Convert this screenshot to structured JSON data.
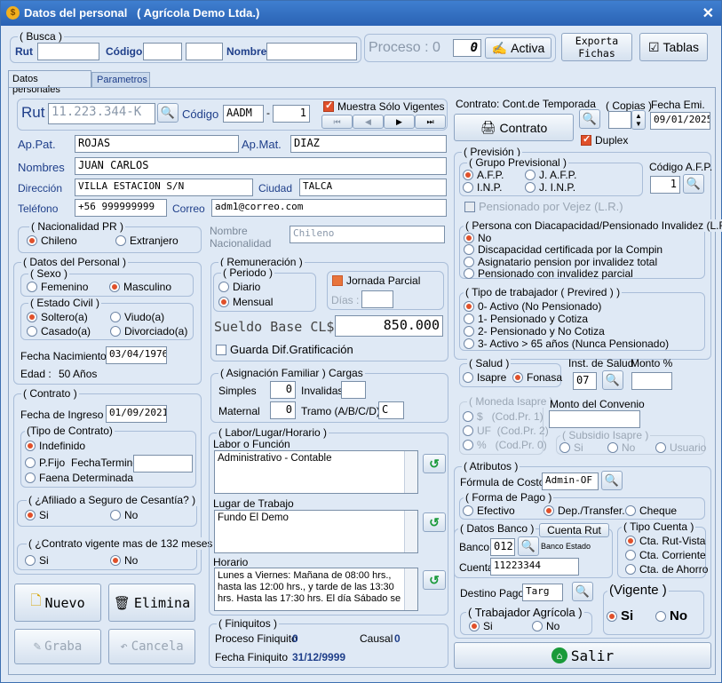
{
  "title": "Datos del personal   ( Agrícola Demo Ltda.)",
  "busca": {
    "group": "( Busca )",
    "rut": "Rut",
    "codigo": "Código",
    "nombre": "Nombre"
  },
  "proceso": {
    "label": "Proceso : 0",
    "value": "0",
    "activa": "Activa",
    "exporta": "Exporta\nFichas",
    "tablas": "Tablas"
  },
  "tabs": [
    "Datos personales",
    "Parametros"
  ],
  "persona": {
    "rut_label": "Rut",
    "rut": "11.223.344-K",
    "codigo_label": "Código",
    "codigo": "AADM",
    "codigo_num": "1",
    "muestra": "Muestra Sólo Vigentes",
    "appat_label": "Ap.Pat.",
    "appat": "ROJAS",
    "apmat_label": "Ap.Mat.",
    "apmat": "DIAZ",
    "nombres_label": "Nombres",
    "nombres": "JUAN CARLOS",
    "direccion_label": "Dirección",
    "direccion": "VILLA ESTACION S/N",
    "ciudad_label": "Ciudad",
    "ciudad": "TALCA",
    "telefono_label": "Teléfono",
    "telefono": "+56 999999999",
    "correo_label": "Correo",
    "correo": "adm1@correo.com",
    "nacionalidad_pr": "( Nacionalidad PR )",
    "chileno": "Chileno",
    "extranjero": "Extranjero",
    "nombre_nac_label1": "Nombre",
    "nombre_nac_label2": "Nacionalidad",
    "nombre_nac": "Chileno"
  },
  "datos_personal": {
    "group": "( Datos del Personal )",
    "sexo": "( Sexo )",
    "femenino": "Femenino",
    "masculino": "Masculino",
    "estado_civil": "( Estado Civil )",
    "soltero": "Soltero(a)",
    "viudo": "Viudo(a)",
    "casado": "Casado(a)",
    "divorciado": "Divorciado(a)",
    "fnac_label": "Fecha Nacimiento",
    "fnac": "03/04/1976",
    "edad_label": "Edad :",
    "edad": "50 Años"
  },
  "contrato": {
    "group": "( Contrato )",
    "fingreso_label": "Fecha de Ingreso",
    "fingreso": "01/09/2021",
    "tipo": "(Tipo de Contrato)",
    "indefinido": "Indefinido",
    "pfijo": "P.Fijo",
    "ftermino": "FechaTermino",
    "faena": "Faena Determinada",
    "afiliado": "( ¿Afiliado a Seguro de Cesantía? )",
    "si": "Si",
    "no": "No",
    "vigente132": "( ¿Contrato vigente mas de 132 meses ? )"
  },
  "buttons": {
    "nuevo": "Nuevo",
    "elimina": "Elimina",
    "graba": "Graba",
    "cancela": "Cancela",
    "salir": "Salir"
  },
  "remuneracion": {
    "group": "( Remuneración )",
    "periodo": "( Periodo )",
    "diario": "Diario",
    "mensual": "Mensual",
    "jornada": "Jornada Parcial",
    "dias": "Días :",
    "sueldo_label": "Sueldo Base CL$",
    "sueldo": "850.000",
    "guarda": "Guarda Dif.Gratificación"
  },
  "asignacion": {
    "group": "( Asignación Familiar ) Cargas",
    "simples": "Simples",
    "simples_v": "0",
    "invalidas": "Invalidas",
    "maternal": "Maternal",
    "maternal_v": "0",
    "tramo": "Tramo (A/B/C/D)",
    "tramo_v": "C"
  },
  "labor": {
    "group": "( Labor/Lugar/Horario )",
    "labor_label": "Labor o Función",
    "labor": "Administrativo - Contable",
    "lugar_label": "Lugar de Trabajo",
    "lugar": "Fundo El Demo",
    "horario_label": "Horario",
    "horario": "Lunes a Viernes: Mañana de 08:00 hrs.,\nhasta las 12:00 hrs., y tarde de las 13:30\nhrs. Hasta las 17:30 hrs.  El día Sábado se"
  },
  "finiquitos": {
    "group": "( Finiquitos )",
    "proceso_label": "Proceso Finiquito",
    "proceso": "0",
    "causal_label": "Causal",
    "causal": "0",
    "fecha_label": "Fecha  Finiquito",
    "fecha": "31/12/9999"
  },
  "contrato_doc": {
    "label": "Contrato: Cont.de Temporada",
    "copias": "( Copias )",
    "fecha_emi_label": "Fecha Emi.",
    "fecha_emi": "09/01/2025",
    "contrato_btn": "Contrato",
    "duplex": "Duplex"
  },
  "prevision": {
    "group": "( Previsión )",
    "grupo": "( Grupo Previsional )",
    "afp": "A.F.P.",
    "jafp": "J. A.F.P.",
    "inp": "I.N.P.",
    "jinp": "J. I.N.P.",
    "codigo_afp_label": "Código A.F.P.",
    "codigo_afp": "1",
    "pensionado_vejez": "Pensionado por Vejez (L.R.)",
    "discap": "( Persona con Diacapacidad/Pensionado Invalidez (L.R.) )",
    "d_no": "No",
    "d_1": "Discapacidad certificada por la Compin",
    "d_2": "Asignatario pension por invalidez total",
    "d_3": "Pensionado con invalidez parcial",
    "tipo_trab": "( Tipo de trabajador  ( Previred ) )",
    "t0": "0- Activo (No Pensionado)",
    "t1": "1- Pensionado y Cotiza",
    "t2": "2- Pensionado y No Cotiza",
    "t3": "3- Activo > 65 años (Nunca Pensionado)"
  },
  "salud": {
    "group": "( Salud )",
    "isapre": "Isapre",
    "fonasa": "Fonasa",
    "inst_label": "Inst. de Salud",
    "inst": "07",
    "monto_label": "Monto %",
    "moneda": "( Moneda Isapre )",
    "m1": "$   (Cod.Pr. 1)",
    "m2": "UF  (Cod.Pr. 2)",
    "m3": "%   (Cod.Pr. 0)",
    "monto_conv": "Monto del Convenio",
    "subsidio": "( Subsidio Isapre )",
    "s_si": "Si",
    "s_no": "No",
    "s_usuario": "Usuario"
  },
  "atributos": {
    "group": "( Atributos )",
    "formula_label": "Fórmula de Costo",
    "formula": "Admin-OF",
    "forma_pago": "( Forma de Pago )",
    "efectivo": "Efectivo",
    "dep": "Dep./Transfer.",
    "cheque": "Cheque",
    "datos_banco": "( Datos Banco )",
    "cuenta_rut": "Cuenta Rut",
    "banco_label": "Banco",
    "banco": "012",
    "banco_nombre": "Banco Estado",
    "cuenta_label": "Cuenta",
    "cuenta": "11223344",
    "tipo_cuenta": "( Tipo Cuenta )",
    "ct_rut": "Cta. Rut-Vista",
    "ct_cte": "Cta. Corriente",
    "ct_ahorro": "Cta. de Ahorro",
    "destino_label": "Destino Pago",
    "destino": "Targ",
    "trab_agricola": "( Trabajador Agrícola )",
    "vigente": "(Vigente )",
    "si": "Si",
    "no": "No"
  }
}
